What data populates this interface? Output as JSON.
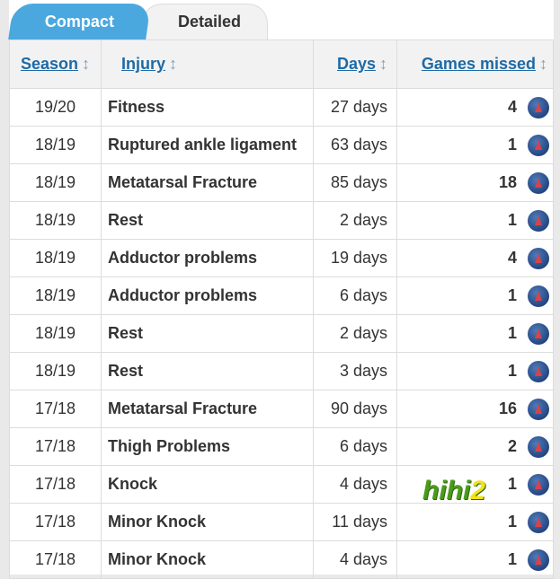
{
  "tabs": [
    {
      "label": "Compact",
      "active": true
    },
    {
      "label": "Detailed",
      "active": false
    }
  ],
  "accent": "#4ba8df",
  "columns": [
    "Season",
    "Injury",
    "Days",
    "Games missed"
  ],
  "sort_icon": "↕",
  "club_icon": "psg-badge-icon",
  "rows": [
    {
      "season": "19/20",
      "injury": "Fitness",
      "days": "27 days",
      "games": "4"
    },
    {
      "season": "18/19",
      "injury": "Ruptured ankle ligament",
      "days": "63 days",
      "games": "1"
    },
    {
      "season": "18/19",
      "injury": "Metatarsal Fracture",
      "days": "85 days",
      "games": "18"
    },
    {
      "season": "18/19",
      "injury": "Rest",
      "days": "2 days",
      "games": "1"
    },
    {
      "season": "18/19",
      "injury": "Adductor problems",
      "days": "19 days",
      "games": "4"
    },
    {
      "season": "18/19",
      "injury": "Adductor problems",
      "days": "6 days",
      "games": "1"
    },
    {
      "season": "18/19",
      "injury": "Rest",
      "days": "2 days",
      "games": "1"
    },
    {
      "season": "18/19",
      "injury": "Rest",
      "days": "3 days",
      "games": "1"
    },
    {
      "season": "17/18",
      "injury": "Metatarsal Fracture",
      "days": "90 days",
      "games": "16"
    },
    {
      "season": "17/18",
      "injury": "Thigh Problems",
      "days": "6 days",
      "games": "2"
    },
    {
      "season": "17/18",
      "injury": "Knock",
      "days": "4 days",
      "games": "1"
    },
    {
      "season": "17/18",
      "injury": "Minor Knock",
      "days": "11 days",
      "games": "1"
    },
    {
      "season": "17/18",
      "injury": "Minor Knock",
      "days": "4 days",
      "games": "1"
    }
  ],
  "watermark": {
    "text": "hihi",
    "accent": "2"
  }
}
